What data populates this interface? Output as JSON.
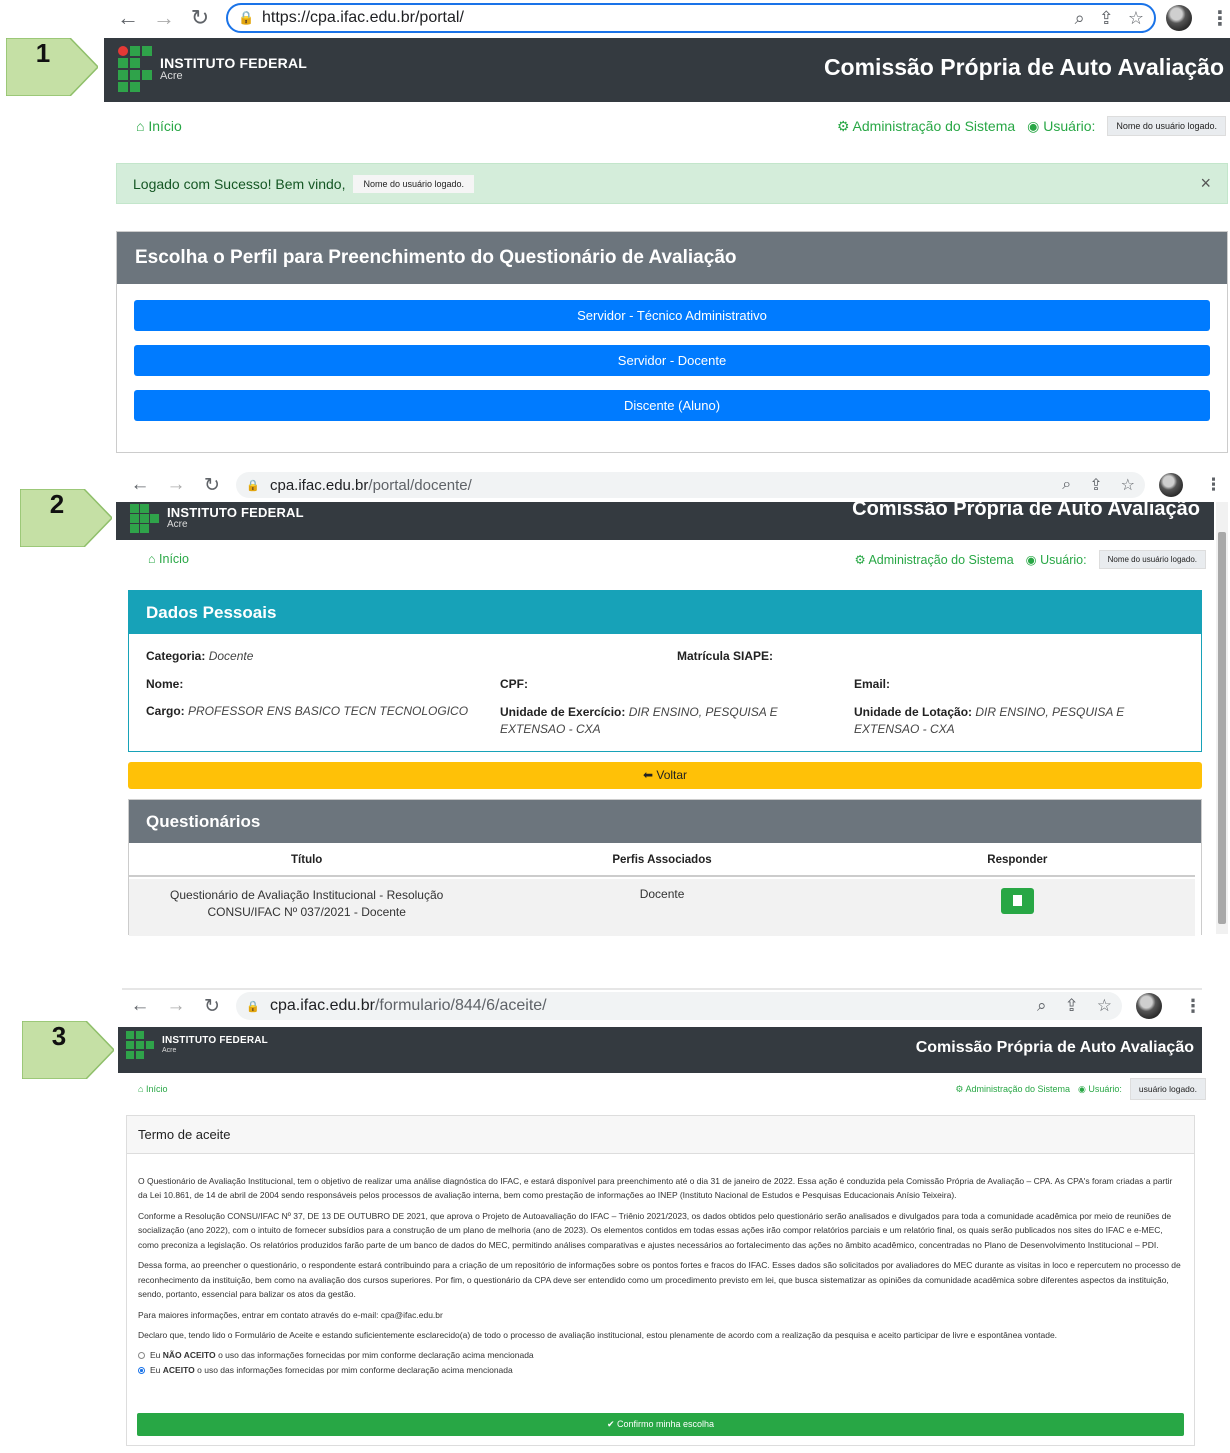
{
  "steps": [
    "1",
    "2",
    "3"
  ],
  "site": {
    "logo_line1": "INSTITUTO FEDERAL",
    "logo_line2": "Acre",
    "title": "Comissão Própria de Auto Avaliação",
    "nav_home": "Início",
    "nav_admin": "Administração do Sistema",
    "nav_user_label": "Usuário:"
  },
  "screen1": {
    "url": "https://cpa.ifac.edu.br/portal/",
    "user_chip": "Nome do usuário logado.",
    "alert_text": "Logado com Sucesso! Bem vindo,",
    "alert_user": "Nome do usuário logado.",
    "alert_close": "×",
    "profile_title": "Escolha o Perfil para Preenchimento do Questionário de Avaliação",
    "profile_buttons": [
      "Servidor - Técnico Administrativo",
      "Servidor - Docente",
      "Discente (Aluno)"
    ]
  },
  "screen2": {
    "url_host": "cpa.ifac.edu.br",
    "url_path": "/portal/docente/",
    "user_chip": "Nome do usuário logado.",
    "dados_title": "Dados Pessoais",
    "categoria_label": "Categoria:",
    "categoria_value": "Docente",
    "matricula_label": "Matrícula SIAPE:",
    "nome_label": "Nome:",
    "cpf_label": "CPF:",
    "email_label": "Email:",
    "cargo_label": "Cargo:",
    "cargo_value": "PROFESSOR ENS BASICO TECN TECNOLOGICO",
    "exercicio_label": "Unidade de Exercício:",
    "exercicio_value": "DIR ENSINO, PESQUISA E EXTENSAO - CXA",
    "lotacao_label": "Unidade de Lotação:",
    "lotacao_value": "DIR ENSINO, PESQUISA E EXTENSAO - CXA",
    "voltar_label": "Voltar",
    "quest_title": "Questionários",
    "columns": [
      "Título",
      "Perfis Associados",
      "Responder"
    ],
    "rows": [
      {
        "titulo": "Questionário de Avaliação Institucional - Resolução CONSU/IFAC Nº 037/2021 - Docente",
        "perfis": "Docente"
      }
    ]
  },
  "screen3": {
    "url_host": "cpa.ifac.edu.br",
    "url_path": "/formulario/844/6/aceite/",
    "user_chip": "usuário logado.",
    "term_title": "Termo de aceite",
    "paragraphs": [
      "O Questionário de Avaliação Institucional, tem o objetivo de realizar uma análise diagnóstica do IFAC, e estará disponível para preenchimento até o dia 31 de janeiro de 2022. Essa ação é conduzida pela Comissão Própria de Avaliação – CPA. As CPA's foram criadas a partir da Lei 10.861, de 14 de abril de 2004 sendo responsáveis pelos processos de avaliação interna, bem como prestação de informações ao INEP (Instituto Nacional de Estudos e Pesquisas Educacionais Anísio Teixeira).",
      "Conforme a Resolução CONSU/IFAC Nº 37, DE 13 DE OUTUBRO DE 2021, que aprova o Projeto de Autoavaliação do IFAC – Triênio 2021/2023, os dados obtidos pelo questionário serão analisados e divulgados para toda a comunidade acadêmica por meio de reuniões de socialização (ano 2022), com o intuito de fornecer subsídios para a construção de um plano de melhoria (ano de 2023). Os elementos contidos em todas essas ações irão compor relatórios parciais e um relatório final, os quais serão publicados nos sites do IFAC e e-MEC, como preconiza a legislação. Os relatórios produzidos farão parte de um banco de dados do MEC, permitindo análises comparativas e ajustes necessários ao fortalecimento das ações no âmbito acadêmico, concentradas no Plano de Desenvolvimento Institucional – PDI.",
      "Dessa forma, ao preencher o questionário, o respondente estará contribuindo para a criação de um repositório de informações sobre os pontos fortes e fracos do IFAC. Esses dados são solicitados por avaliadores do MEC durante as visitas in loco e repercutem no processo de reconhecimento da instituição, bem como na avaliação dos cursos superiores. Por fim, o questionário da CPA deve ser entendido como um procedimento previsto em lei, que busca sistematizar as opiniões da comunidade acadêmica sobre diferentes aspectos da instituição, sendo, portanto, essencial para balizar os atos da gestão.",
      "Para maiores informações, entrar em contato através do e-mail: cpa@ifac.edu.br",
      "Declaro que, tendo lido o Formulário de Aceite e estando suficientemente esclarecido(a) de todo o processo de avaliação institucional, estou plenamente de acordo com a realização da pesquisa e aceito participar de livre e espontânea vontade."
    ],
    "option_no_prefix": "Eu",
    "option_no_strong": "NÃO ACEITO",
    "option_no_rest": "o uso das informações fornecidas por mim conforme declaração acima mencionada",
    "option_yes_prefix": "Eu",
    "option_yes_strong": "ACEITO",
    "option_yes_rest": "o uso das informações fornecidas por mim conforme declaração acima mencionada",
    "selected_option": "ACEITO",
    "confirm_label": "Confirmo minha escolha"
  },
  "colors": {
    "header_dark": "#343a40",
    "ifac_green": "#2fa34a",
    "nav_green": "#28a745",
    "primary_blue": "#007bff",
    "info_teal": "#17a2b8",
    "warning_yellow": "#ffc107",
    "step_arrow": "#c5e0a5"
  }
}
